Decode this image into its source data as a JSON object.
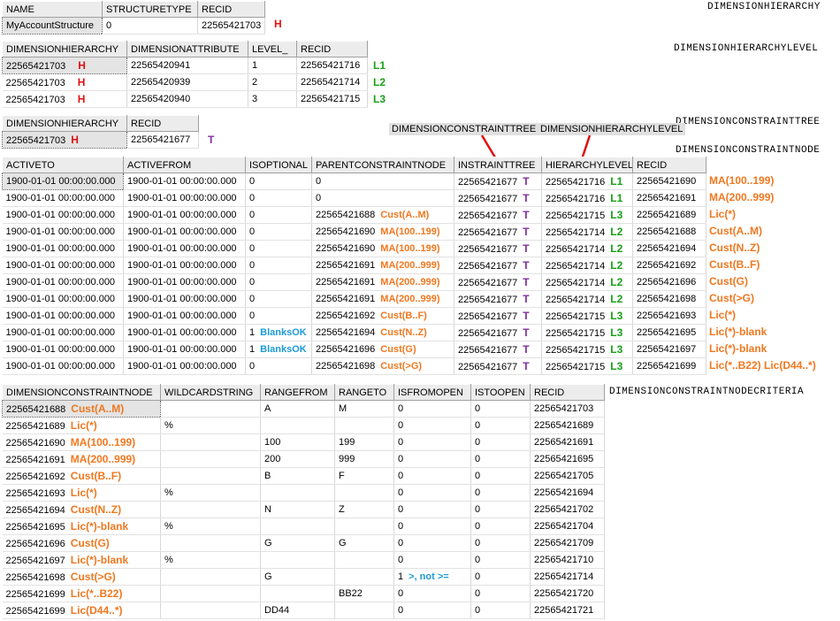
{
  "table_names": {
    "dimensionhierarchy": "DIMENSIONHIERARCHY",
    "dimensionhierarchylevel": "DIMENSIONHIERARCHYLEVEL",
    "dimensionconstrainttree": "DIMENSIONCONSTRAINTTREE",
    "dimensionconstraintnode": "DIMENSIONCONSTRAINTNODE",
    "dimensionconstraintnodecriteria": "DIMENSIONCONSTRAINTNODECRITERIA"
  },
  "colors": {
    "hierarchy_marker": "#e01010",
    "level_marker": "#18a018",
    "tree_marker": "#8030a0",
    "node_label": "#f07820",
    "note": "#1c9ad6"
  },
  "hierarchy": {
    "columns": [
      "NAME",
      "STRUCTURETYPE",
      "RECID"
    ],
    "rows": [
      {
        "name": "MyAccountStructure",
        "structuretype": "0",
        "recid": "22565421703",
        "marker": "H"
      }
    ]
  },
  "hierarchy_level": {
    "columns": [
      "DIMENSIONHIERARCHY",
      "DIMENSIONATTRIBUTE",
      "LEVEL_",
      "RECID"
    ],
    "rows": [
      {
        "hierarchy": "22565421703",
        "h": "H",
        "attribute": "22565420941",
        "level": "1",
        "recid": "22565421716",
        "tag": "L1"
      },
      {
        "hierarchy": "22565421703",
        "h": "H",
        "attribute": "22565420939",
        "level": "2",
        "recid": "22565421714",
        "tag": "L2"
      },
      {
        "hierarchy": "22565421703",
        "h": "H",
        "attribute": "22565420940",
        "level": "3",
        "recid": "22565421715",
        "tag": "L3"
      }
    ]
  },
  "constraint_tree": {
    "columns": [
      "DIMENSIONHIERARCHY",
      "RECID"
    ],
    "rows": [
      {
        "hierarchy": "22565421703",
        "h": "H",
        "recid": "22565421677",
        "tag": "T"
      }
    ]
  },
  "fk_labels": {
    "tree": "DIMENSIONCONSTRAINTTREE",
    "level": "DIMENSIONHIERARCHYLEVEL"
  },
  "constraint_node": {
    "columns": [
      "ACTIVETO",
      "ACTIVEFROM",
      "ISOPTIONAL",
      "PARENTCONSTRAINTNODE",
      "INSTRAINTTREE",
      "HIERARCHYLEVEL",
      "RECID"
    ],
    "rows": [
      {
        "activeto": "1900-01-01 00:00:00.000",
        "activefrom": "1900-01-01 00:00:00.000",
        "optional": "0",
        "opt_note": "",
        "parent": "0",
        "parent_label": "",
        "tree": "22565421677",
        "t": "T",
        "level": "22565421716",
        "level_tag": "L1",
        "recid": "22565421690",
        "label": "MA(100..199)"
      },
      {
        "activeto": "1900-01-01 00:00:00.000",
        "activefrom": "1900-01-01 00:00:00.000",
        "optional": "0",
        "opt_note": "",
        "parent": "0",
        "parent_label": "",
        "tree": "22565421677",
        "t": "T",
        "level": "22565421716",
        "level_tag": "L1",
        "recid": "22565421691",
        "label": "MA(200..999)"
      },
      {
        "activeto": "1900-01-01 00:00:00.000",
        "activefrom": "1900-01-01 00:00:00.000",
        "optional": "0",
        "opt_note": "",
        "parent": "22565421688",
        "parent_label": "Cust(A..M)",
        "tree": "22565421677",
        "t": "T",
        "level": "22565421715",
        "level_tag": "L3",
        "recid": "22565421689",
        "label": "Lic(*)"
      },
      {
        "activeto": "1900-01-01 00:00:00.000",
        "activefrom": "1900-01-01 00:00:00.000",
        "optional": "0",
        "opt_note": "",
        "parent": "22565421690",
        "parent_label": "MA(100..199)",
        "tree": "22565421677",
        "t": "T",
        "level": "22565421714",
        "level_tag": "L2",
        "recid": "22565421688",
        "label": "Cust(A..M)"
      },
      {
        "activeto": "1900-01-01 00:00:00.000",
        "activefrom": "1900-01-01 00:00:00.000",
        "optional": "0",
        "opt_note": "",
        "parent": "22565421690",
        "parent_label": "MA(100..199)",
        "tree": "22565421677",
        "t": "T",
        "level": "22565421714",
        "level_tag": "L2",
        "recid": "22565421694",
        "label": "Cust(N..Z)"
      },
      {
        "activeto": "1900-01-01 00:00:00.000",
        "activefrom": "1900-01-01 00:00:00.000",
        "optional": "0",
        "opt_note": "",
        "parent": "22565421691",
        "parent_label": "MA(200..999)",
        "tree": "22565421677",
        "t": "T",
        "level": "22565421714",
        "level_tag": "L2",
        "recid": "22565421692",
        "label": "Cust(B..F)"
      },
      {
        "activeto": "1900-01-01 00:00:00.000",
        "activefrom": "1900-01-01 00:00:00.000",
        "optional": "0",
        "opt_note": "",
        "parent": "22565421691",
        "parent_label": "MA(200..999)",
        "tree": "22565421677",
        "t": "T",
        "level": "22565421714",
        "level_tag": "L2",
        "recid": "22565421696",
        "label": "Cust(G)"
      },
      {
        "activeto": "1900-01-01 00:00:00.000",
        "activefrom": "1900-01-01 00:00:00.000",
        "optional": "0",
        "opt_note": "",
        "parent": "22565421691",
        "parent_label": "MA(200..999)",
        "tree": "22565421677",
        "t": "T",
        "level": "22565421714",
        "level_tag": "L2",
        "recid": "22565421698",
        "label": "Cust(>G)"
      },
      {
        "activeto": "1900-01-01 00:00:00.000",
        "activefrom": "1900-01-01 00:00:00.000",
        "optional": "0",
        "opt_note": "",
        "parent": "22565421692",
        "parent_label": "Cust(B..F)",
        "tree": "22565421677",
        "t": "T",
        "level": "22565421715",
        "level_tag": "L3",
        "recid": "22565421693",
        "label": "Lic(*)"
      },
      {
        "activeto": "1900-01-01 00:00:00.000",
        "activefrom": "1900-01-01 00:00:00.000",
        "optional": "1",
        "opt_note": "BlanksOK",
        "parent": "22565421694",
        "parent_label": "Cust(N..Z)",
        "tree": "22565421677",
        "t": "T",
        "level": "22565421715",
        "level_tag": "L3",
        "recid": "22565421695",
        "label": "Lic(*)-blank"
      },
      {
        "activeto": "1900-01-01 00:00:00.000",
        "activefrom": "1900-01-01 00:00:00.000",
        "optional": "1",
        "opt_note": "BlanksOK",
        "parent": "22565421696",
        "parent_label": "Cust(G)",
        "tree": "22565421677",
        "t": "T",
        "level": "22565421715",
        "level_tag": "L3",
        "recid": "22565421697",
        "label": "Lic(*)-blank"
      },
      {
        "activeto": "1900-01-01 00:00:00.000",
        "activefrom": "1900-01-01 00:00:00.000",
        "optional": "0",
        "opt_note": "",
        "parent": "22565421698",
        "parent_label": "Cust(>G)",
        "tree": "22565421677",
        "t": "T",
        "level": "22565421715",
        "level_tag": "L3",
        "recid": "22565421699",
        "label": "Lic(*..B22) Lic(D44..*)"
      }
    ]
  },
  "criteria": {
    "columns": [
      "DIMENSIONCONSTRAINTNODE",
      "WILDCARDSTRING",
      "RANGEFROM",
      "RANGETO",
      "ISFROMOPEN",
      "ISTOOPEN",
      "RECID"
    ],
    "rows": [
      {
        "node": "22565421688",
        "label": "Cust(A..M)",
        "wildcard": "",
        "from": "A",
        "to": "M",
        "fromopen": "0",
        "fromnote": "",
        "toopen": "0",
        "recid": "22565421703"
      },
      {
        "node": "22565421689",
        "label": "Lic(*)",
        "wildcard": "%",
        "from": "",
        "to": "",
        "fromopen": "0",
        "fromnote": "",
        "toopen": "0",
        "recid": "22565421689"
      },
      {
        "node": "22565421690",
        "label": "MA(100..199)",
        "wildcard": "",
        "from": "100",
        "to": "199",
        "fromopen": "0",
        "fromnote": "",
        "toopen": "0",
        "recid": "22565421691"
      },
      {
        "node": "22565421691",
        "label": "MA(200..999)",
        "wildcard": "",
        "from": "200",
        "to": "999",
        "fromopen": "0",
        "fromnote": "",
        "toopen": "0",
        "recid": "22565421695"
      },
      {
        "node": "22565421692",
        "label": "Cust(B..F)",
        "wildcard": "",
        "from": "B",
        "to": "F",
        "fromopen": "0",
        "fromnote": "",
        "toopen": "0",
        "recid": "22565421705"
      },
      {
        "node": "22565421693",
        "label": "Lic(*)",
        "wildcard": "%",
        "from": "",
        "to": "",
        "fromopen": "0",
        "fromnote": "",
        "toopen": "0",
        "recid": "22565421694"
      },
      {
        "node": "22565421694",
        "label": "Cust(N..Z)",
        "wildcard": "",
        "from": "N",
        "to": "Z",
        "fromopen": "0",
        "fromnote": "",
        "toopen": "0",
        "recid": "22565421702"
      },
      {
        "node": "22565421695",
        "label": "Lic(*)-blank",
        "wildcard": "%",
        "from": "",
        "to": "",
        "fromopen": "0",
        "fromnote": "",
        "toopen": "0",
        "recid": "22565421704"
      },
      {
        "node": "22565421696",
        "label": "Cust(G)",
        "wildcard": "",
        "from": "G",
        "to": "G",
        "fromopen": "0",
        "fromnote": "",
        "toopen": "0",
        "recid": "22565421709"
      },
      {
        "node": "22565421697",
        "label": "Lic(*)-blank",
        "wildcard": "%",
        "from": "",
        "to": "",
        "fromopen": "0",
        "fromnote": "",
        "toopen": "0",
        "recid": "22565421710"
      },
      {
        "node": "22565421698",
        "label": "Cust(>G)",
        "wildcard": "",
        "from": "G",
        "to": "",
        "fromopen": "1",
        "fromnote": ">, not >=",
        "toopen": "0",
        "recid": "22565421714"
      },
      {
        "node": "22565421699",
        "label": "Lic(*..B22)",
        "wildcard": "",
        "from": "",
        "to": "BB22",
        "fromopen": "0",
        "fromnote": "",
        "toopen": "0",
        "recid": "22565421720"
      },
      {
        "node": "22565421699",
        "label": "Lic(D44..*)",
        "wildcard": "",
        "from": "DD44",
        "to": "",
        "fromopen": "0",
        "fromnote": "",
        "toopen": "0",
        "recid": "22565421721"
      }
    ]
  }
}
